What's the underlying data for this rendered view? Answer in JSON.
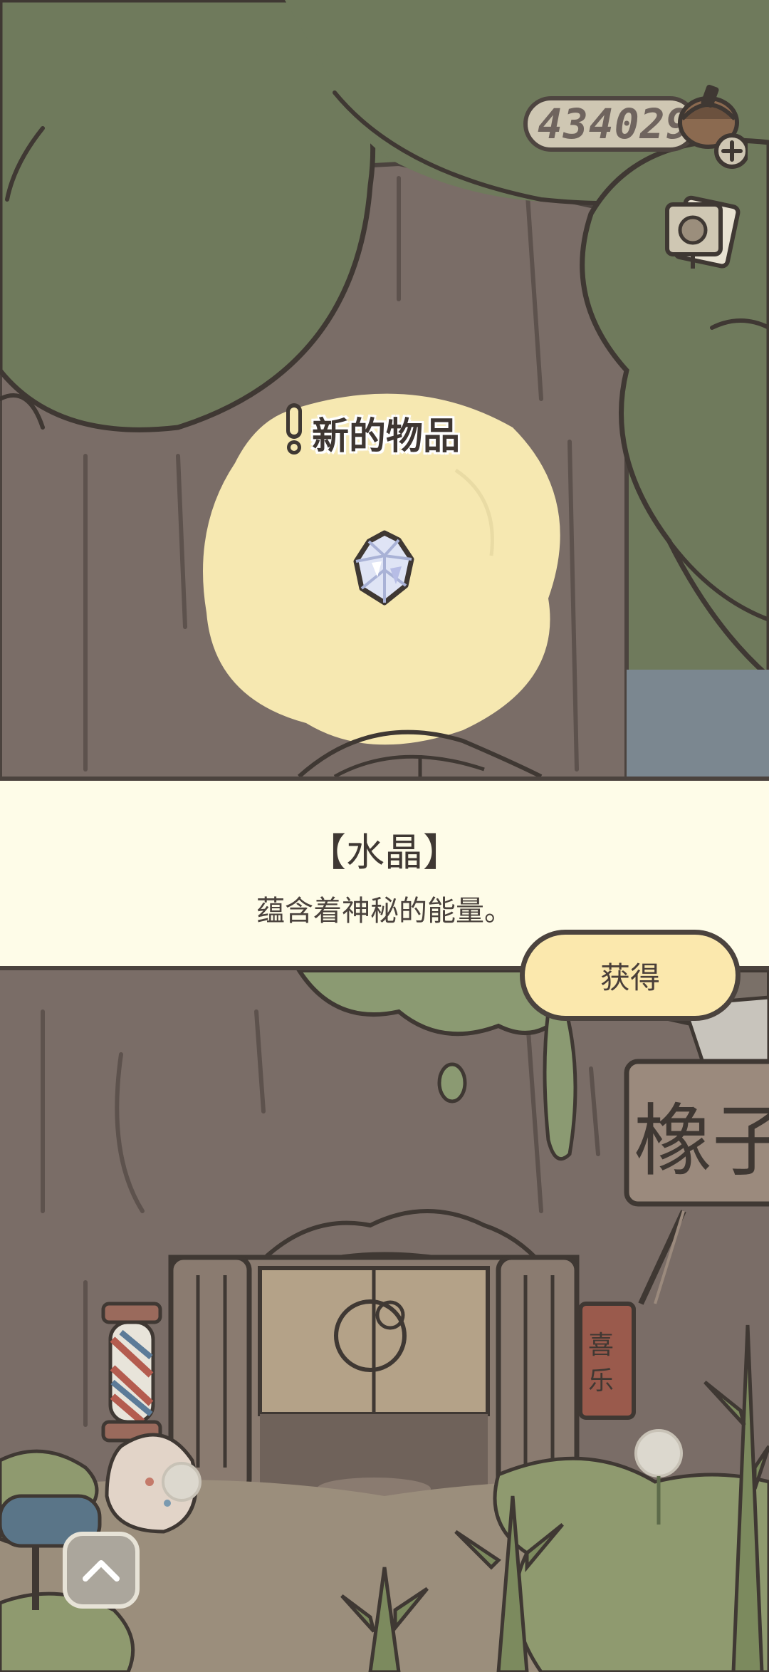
{
  "currency": {
    "acorn_count": "434029",
    "icon": "acorn-icon",
    "add_icon": "plus-icon"
  },
  "photo_button": {
    "icon": "photo-icon"
  },
  "new_item": {
    "label": "新的物品",
    "icon": "crystal-icon",
    "alert_icon": "exclamation-icon"
  },
  "banner": {
    "item_name": "【水晶】",
    "description": "蕴含着神秘的能量。"
  },
  "obtain_button": {
    "label": "获得"
  },
  "shop_sign": {
    "text": "橡子"
  },
  "couplet": {
    "text": "喜乐"
  },
  "expand_button": {
    "icon": "chevron-up-icon"
  },
  "colors": {
    "foliage": "#6f7a5c",
    "trunk": "#7a6d67",
    "spotlight": "#f6e8b1",
    "banner": "#fefce8",
    "button": "#fbe8ad",
    "outline": "#4b433e"
  }
}
